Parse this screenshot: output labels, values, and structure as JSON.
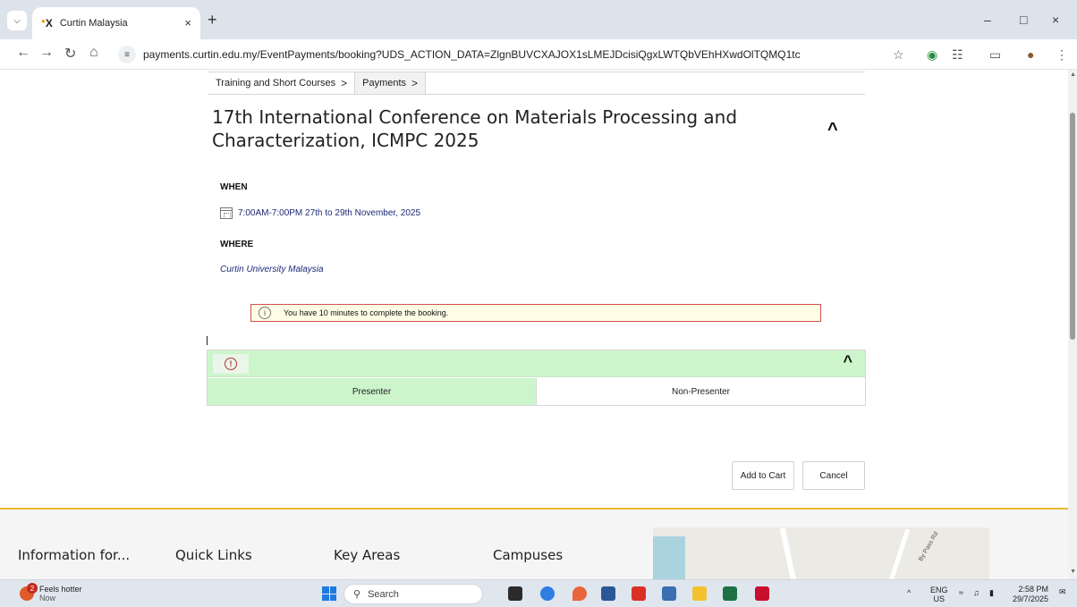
{
  "browser": {
    "tab_title": "Curtin Malaysia",
    "tab_favicon": "X",
    "tab_close": "×",
    "new_tab": "+",
    "url": "payments.curtin.edu.my/EventPayments/booking?UDS_ACTION_DATA=ZlgnBUVCXAJOX1sLMEJDcisiQgxLWTQbVEhHXwdOlTQMQ1tc",
    "window_controls": [
      "–",
      "□",
      "×"
    ],
    "icons": [
      "tab-search-icon",
      "back-icon",
      "forward-icon",
      "reload-icon",
      "home-icon",
      "site-info-icon",
      "bookmark-star-icon",
      "extension-icon",
      "puzzle-icon",
      "cast-icon",
      "profile-icon",
      "menu-icon"
    ]
  },
  "breadcrumb": {
    "items": [
      {
        "label": "Training and Short Courses",
        "chevron": ">"
      },
      {
        "label": "Payments",
        "chevron": ">"
      }
    ]
  },
  "event": {
    "title": "17th International Conference on Materials Processing and Characterization, ICMPC 2025",
    "collapse_symbol": "^",
    "when_label": "WHEN",
    "when_value": "7:00AM-7:00PM 27th to 29th November, 2025",
    "where_label": "WHERE",
    "where_value": "Curtin University Malaysia",
    "notice": "You have 10 minutes to complete the booking."
  },
  "tickets": {
    "warning_symbol": "!",
    "collapse_symbol": "^",
    "options": [
      {
        "label": "Presenter",
        "selected": true
      },
      {
        "label": "Non-Presenter",
        "selected": false
      }
    ],
    "colors": {
      "selected": "#ccf5cc",
      "header": "#ccf5cc"
    }
  },
  "actions": {
    "add_to_cart": "Add to Cart",
    "cancel": "Cancel"
  },
  "footer": {
    "accent": "#e8b731",
    "columns": [
      "Information for...",
      "Quick Links",
      "Key Areas",
      "Campuses"
    ],
    "map_label": "By Pass Rd"
  },
  "taskbar": {
    "weather_badge": "2",
    "weather_title": "Feels hotter",
    "weather_sub": "Now",
    "search_placeholder": "Search",
    "lang_top": "ENG",
    "lang_bottom": "US",
    "time": "2:58 PM",
    "date": "29/7/2025",
    "tray_chevron": "^"
  }
}
